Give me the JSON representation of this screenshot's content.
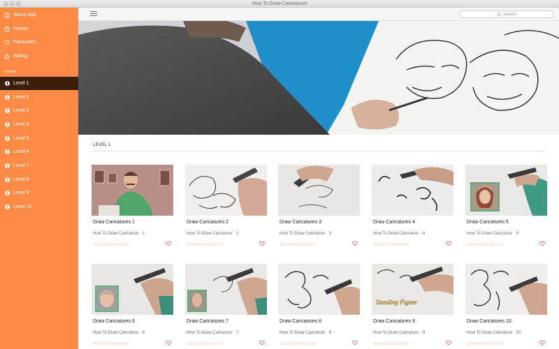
{
  "window": {
    "title": "How To Draw Caricatures"
  },
  "toolbar": {
    "search_placeholder": "Search"
  },
  "sidebar": {
    "top_items": [
      {
        "label": "About App",
        "icon": "info-icon"
      },
      {
        "label": "History",
        "icon": "clock-icon"
      },
      {
        "label": "Favourites",
        "icon": "heart-icon"
      },
      {
        "label": "Rating",
        "icon": "star-icon"
      }
    ],
    "section_label": "Levels",
    "levels": [
      {
        "label": "Level 1",
        "active": true
      },
      {
        "label": "Level 2"
      },
      {
        "label": "Level 3"
      },
      {
        "label": "Level 4"
      },
      {
        "label": "Level 5"
      },
      {
        "label": "Level 6"
      },
      {
        "label": "Level 7"
      },
      {
        "label": "Level 8"
      },
      {
        "label": "Level 9"
      },
      {
        "label": "Level 10"
      }
    ]
  },
  "main": {
    "section_title": "LEVEL 1",
    "cards": [
      {
        "title": "Draw Caricatures 1",
        "subtitle": "How To Draw Caricature",
        "number": "1"
      },
      {
        "title": "Draw Caricatures 2",
        "subtitle": "How To Draw Caricature",
        "number": "2"
      },
      {
        "title": "Draw Caricatures 3",
        "subtitle": "How To Draw Caricature",
        "number": "3"
      },
      {
        "title": "Draw Caricatures 4",
        "subtitle": "How To Draw Caricature",
        "number": "4"
      },
      {
        "title": "Draw Caricatures 5",
        "subtitle": "How To Draw Caricature",
        "number": "5"
      },
      {
        "title": "Draw Caricatures 6",
        "subtitle": "How To Draw Caricature",
        "number": "6"
      },
      {
        "title": "Draw Caricatures 7",
        "subtitle": "How To Draw Caricature",
        "number": "7"
      },
      {
        "title": "Draw Caricatures 8",
        "subtitle": "How To Draw Caricature",
        "number": "8"
      },
      {
        "title": "Draw Caricatures 9",
        "subtitle": "How To Draw Caricature",
        "number": "9"
      },
      {
        "title": "Draw Caricatures 10",
        "subtitle": "How To Draw Caricature",
        "number": "10"
      }
    ],
    "rating_stars": "☆☆☆☆☆☆☆☆☆☆"
  },
  "colors": {
    "sidebar": "#fd8b45",
    "sidebar_active": "#3a1d0a",
    "accent": "#f08a4b"
  }
}
